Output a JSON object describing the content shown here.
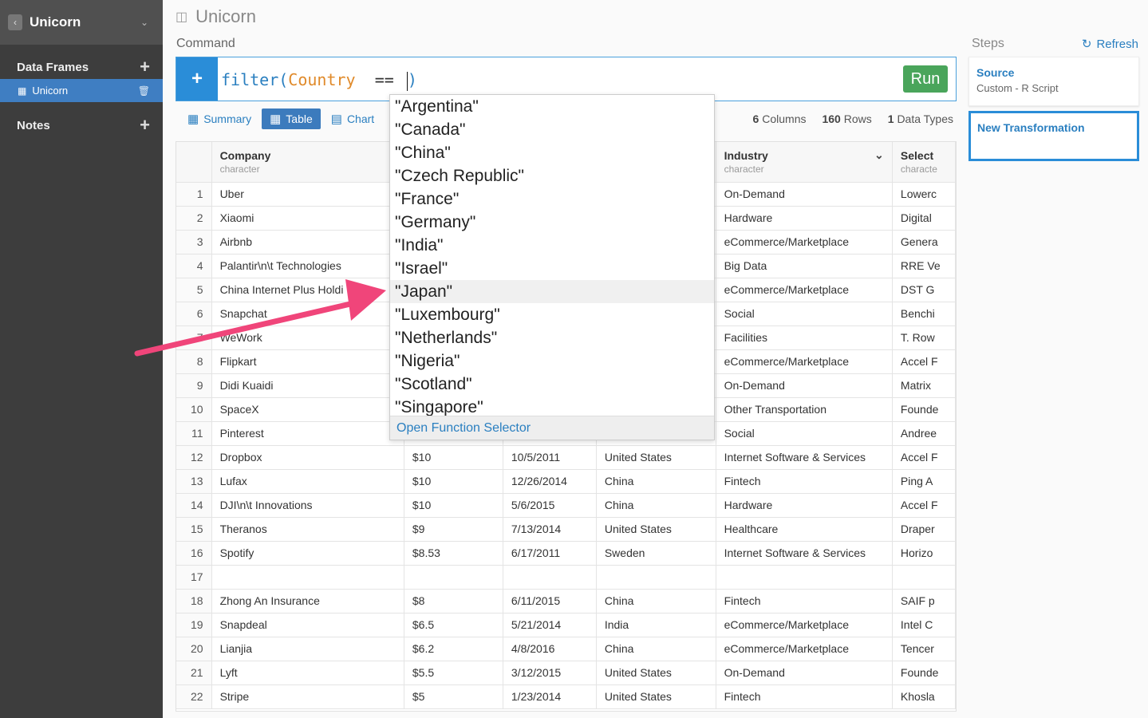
{
  "sidebar": {
    "title": "Unicorn",
    "data_frames_label": "Data Frames",
    "active_frame": "Unicorn",
    "notes_label": "Notes"
  },
  "main": {
    "title": "Unicorn",
    "command_label": "Command",
    "command": {
      "fn": "filter(",
      "column": "Country",
      "operator": "==",
      "close": ")"
    },
    "run_label": "Run"
  },
  "tabs": {
    "summary": "Summary",
    "table": "Table",
    "chart": "Chart"
  },
  "stats": {
    "columns_count": "6",
    "columns_label": "Columns",
    "rows_count": "160",
    "rows_label": "Rows",
    "types_count": "1",
    "types_label": "Data Types"
  },
  "table": {
    "columns": [
      {
        "name": "Company",
        "type": "character"
      },
      {
        "name": "",
        "type": ""
      },
      {
        "name": "",
        "type": ""
      },
      {
        "name": "",
        "type": ""
      },
      {
        "name": "Industry",
        "type": "character"
      },
      {
        "name": "Select",
        "type": "characte"
      }
    ],
    "rows": [
      [
        "1",
        "Uber",
        "",
        "",
        "",
        "On-Demand",
        "Lowerc"
      ],
      [
        "2",
        "Xiaomi",
        "",
        "",
        "",
        "Hardware",
        "Digital"
      ],
      [
        "3",
        "Airbnb",
        "",
        "",
        "",
        "eCommerce/Marketplace",
        "Genera"
      ],
      [
        "4",
        "Palantir\\n\\t  Technologies",
        "",
        "",
        "",
        "Big Data",
        "RRE Ve"
      ],
      [
        "5",
        "China Internet Plus Holdi",
        "",
        "",
        "",
        "eCommerce/Marketplace",
        "DST G"
      ],
      [
        "6",
        "Snapchat",
        "",
        "",
        "",
        "Social",
        "Benchi"
      ],
      [
        "7",
        "WeWork",
        "",
        "",
        "",
        "Facilities",
        "T. Row"
      ],
      [
        "8",
        "Flipkart",
        "",
        "",
        "",
        "eCommerce/Marketplace",
        "Accel F"
      ],
      [
        "9",
        "Didi Kuaidi",
        "",
        "",
        "",
        "On-Demand",
        "Matrix"
      ],
      [
        "10",
        "SpaceX",
        "",
        "",
        "",
        "Other Transportation",
        "Founde"
      ],
      [
        "11",
        "Pinterest",
        "",
        "",
        "",
        "Social",
        "Andree"
      ],
      [
        "12",
        "Dropbox",
        "$10",
        "10/5/2011",
        "United States",
        "Internet Software & Services",
        "Accel F"
      ],
      [
        "13",
        "Lufax",
        "$10",
        "12/26/2014",
        "China",
        "Fintech",
        "Ping A"
      ],
      [
        "14",
        "DJI\\n\\t  Innovations",
        "$10",
        "5/6/2015",
        "China",
        "Hardware",
        "Accel F"
      ],
      [
        "15",
        "Theranos",
        "$9",
        "7/13/2014",
        "United States",
        "Healthcare",
        "Draper"
      ],
      [
        "16",
        "Spotify",
        "$8.53",
        "6/17/2011",
        "Sweden",
        "Internet Software & Services",
        "Horizo"
      ],
      [
        "17",
        "",
        "",
        "",
        "",
        "",
        ""
      ],
      [
        "18",
        "Zhong An Insurance",
        "$8",
        "6/11/2015",
        "China",
        "Fintech",
        "SAIF p"
      ],
      [
        "19",
        "Snapdeal",
        "$6.5",
        "5/21/2014",
        "India",
        "eCommerce/Marketplace",
        "Intel C"
      ],
      [
        "20",
        "Lianjia",
        "$6.2",
        "4/8/2016",
        "China",
        "eCommerce/Marketplace",
        "Tencer"
      ],
      [
        "21",
        "Lyft",
        "$5.5",
        "3/12/2015",
        "United States",
        "On-Demand",
        "Founde"
      ],
      [
        "22",
        "Stripe",
        "$5",
        "1/23/2014",
        "United States",
        "Fintech",
        "Khosla"
      ]
    ]
  },
  "dropdown": {
    "items": [
      "\"Argentina\"",
      "\"Canada\"",
      "\"China\"",
      "\"Czech Republic\"",
      "\"France\"",
      "\"Germany\"",
      "\"India\"",
      "\"Israel\"",
      "\"Japan\"",
      "\"Luxembourg\"",
      "\"Netherlands\"",
      "\"Nigeria\"",
      "\"Scotland\"",
      "\"Singapore\""
    ],
    "highlighted_index": 8,
    "footer": "Open Function Selector"
  },
  "steps": {
    "label": "Steps",
    "refresh_label": "Refresh",
    "source_title": "Source",
    "source_subtitle": "Custom - R Script",
    "new_transformation": "New Transformation"
  },
  "colors": {
    "accent": "#2a8dd8",
    "run_green": "#4aa55b",
    "arrow_pink": "#f0457a",
    "sidebar_bg": "#3d3d3d"
  }
}
